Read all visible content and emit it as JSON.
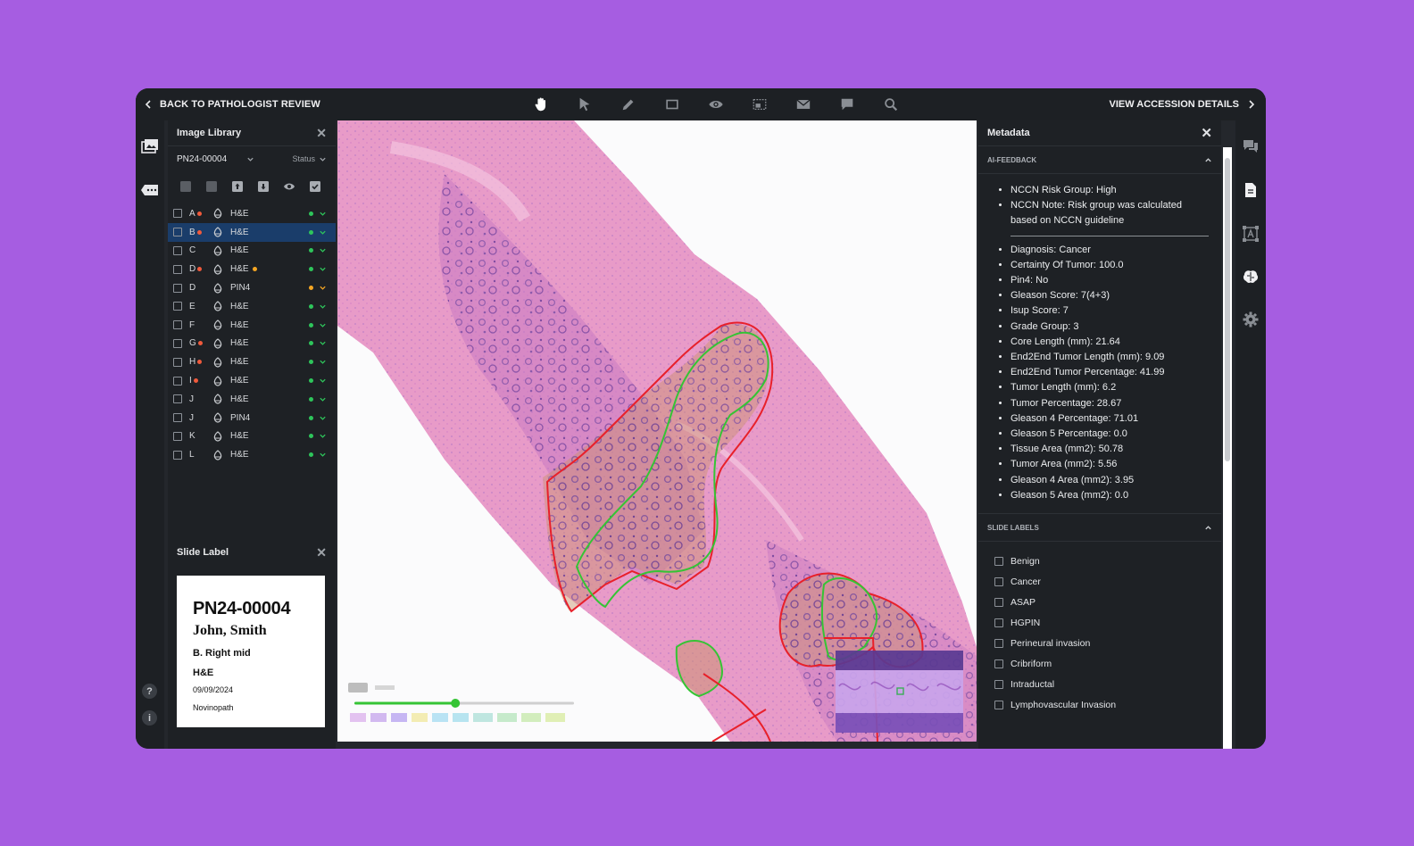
{
  "topbar": {
    "back_label": "BACK TO PATHOLOGIST REVIEW",
    "view_accession_label": "VIEW ACCESSION DETAILS",
    "tools": [
      "hand-icon",
      "pointer-icon",
      "pencil-icon",
      "rectangle-icon",
      "eye-icon",
      "region-select-icon",
      "mail-icon",
      "comment-icon",
      "zoom-search-icon"
    ]
  },
  "image_library": {
    "title": "Image Library",
    "accession_select": "PN24-00004",
    "status_select": "Status",
    "rows": [
      {
        "letter": "A",
        "flag": "#f05a3c",
        "stain": "H&E",
        "stain_dot": null,
        "status": "#2ec55b"
      },
      {
        "letter": "B",
        "flag": "#f05a3c",
        "stain": "H&E",
        "stain_dot": null,
        "status": "#2ec55b",
        "selected": true
      },
      {
        "letter": "C",
        "flag": null,
        "stain": "H&E",
        "stain_dot": null,
        "status": "#2ec55b"
      },
      {
        "letter": "D",
        "flag": "#f05a3c",
        "stain": "H&E",
        "stain_dot": "#f5a623",
        "status": "#2ec55b"
      },
      {
        "letter": "D",
        "flag": null,
        "stain": "PIN4",
        "stain_dot": null,
        "status": "#f5a623"
      },
      {
        "letter": "E",
        "flag": null,
        "stain": "H&E",
        "stain_dot": null,
        "status": "#2ec55b"
      },
      {
        "letter": "F",
        "flag": null,
        "stain": "H&E",
        "stain_dot": null,
        "status": "#2ec55b"
      },
      {
        "letter": "G",
        "flag": "#f05a3c",
        "stain": "H&E",
        "stain_dot": null,
        "status": "#2ec55b"
      },
      {
        "letter": "H",
        "flag": "#f05a3c",
        "stain": "H&E",
        "stain_dot": null,
        "status": "#2ec55b"
      },
      {
        "letter": "I",
        "flag": "#f05a3c",
        "stain": "H&E",
        "stain_dot": null,
        "status": "#2ec55b"
      },
      {
        "letter": "J",
        "flag": null,
        "stain": "H&E",
        "stain_dot": null,
        "status": "#2ec55b"
      },
      {
        "letter": "J",
        "flag": null,
        "stain": "PIN4",
        "stain_dot": null,
        "status": "#2ec55b"
      },
      {
        "letter": "K",
        "flag": null,
        "stain": "H&E",
        "stain_dot": null,
        "status": "#2ec55b"
      },
      {
        "letter": "L",
        "flag": null,
        "stain": "H&E",
        "stain_dot": null,
        "status": "#2ec55b"
      }
    ]
  },
  "slide_label": {
    "title": "Slide Label",
    "accession": "PN24-00004",
    "patient": "John, Smith",
    "site": "B. Right mid",
    "stain": "H&E",
    "date": "09/09/2024",
    "lab": "Novinopath"
  },
  "metadata": {
    "title": "Metadata",
    "ai_feedback_title": "AI-FEEDBACK",
    "nccn_items": [
      "NCCN Risk Group: High",
      "NCCN Note: Risk group was calculated based on NCCN guideline"
    ],
    "ai_items": [
      "Diagnosis: Cancer",
      "Certainty Of Tumor: 100.0",
      "Pin4: No",
      "Gleason Score: 7(4+3)",
      "Isup Score: 7",
      "Grade Group: 3",
      "Core Length (mm): 21.64",
      "End2End Tumor Length (mm): 9.09",
      "End2End Tumor Percentage: 41.99",
      "Tumor Length (mm): 6.2",
      "Tumor Percentage: 28.67",
      "Gleason 4 Percentage: 71.01",
      "Gleason 5 Percentage: 0.0",
      "Tissue Area (mm2): 50.78",
      "Tumor Area (mm2): 5.56",
      "Gleason 4 Area (mm2): 3.95",
      "Gleason 5 Area (mm2): 0.0"
    ],
    "slide_labels_title": "SLIDE LABELS",
    "slide_labels": [
      "Benign",
      "Cancer",
      "ASAP",
      "HGPIN",
      "Perineural invasion",
      "Cribriform",
      "Intraductal",
      "Lymphovascular Invasion"
    ]
  },
  "viewer": {
    "zoom_slider_fraction": 0.46
  },
  "colors": {
    "accent_selected": "#1a3d6a",
    "annotation_red": "#e8202a",
    "annotation_green": "#35c435"
  }
}
